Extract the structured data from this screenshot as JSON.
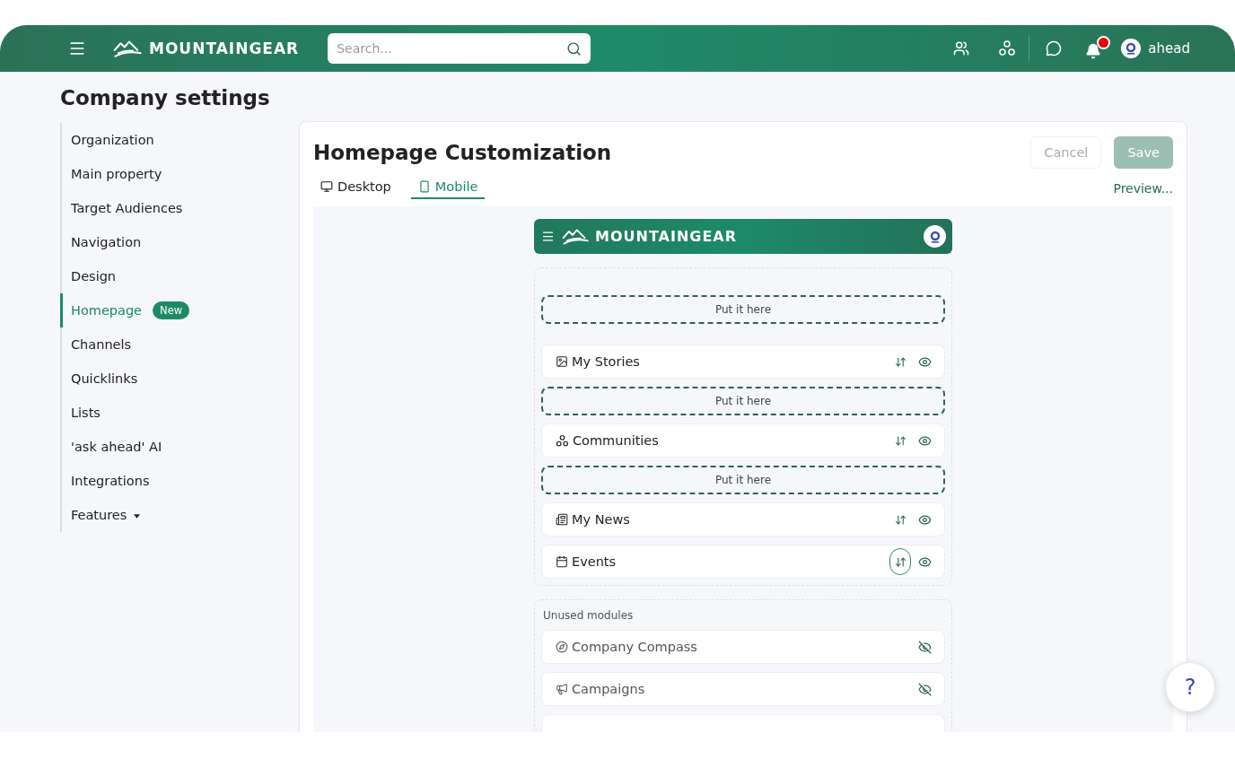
{
  "topbar": {
    "brand": "MOUNTAINGEAR",
    "search": {
      "placeholder": "Search..."
    },
    "notifications": {
      "unread": true
    },
    "user": "ahead"
  },
  "page_title": "Company settings",
  "sidebar": {
    "items": [
      {
        "label": "Organization",
        "selected": false
      },
      {
        "label": "Main property",
        "selected": false
      },
      {
        "label": "Target Audiences",
        "selected": false
      },
      {
        "label": "Navigation",
        "selected": false
      },
      {
        "label": "Design",
        "selected": false
      },
      {
        "label": "Homepage",
        "selected": true,
        "badge": "New"
      },
      {
        "label": "Channels",
        "selected": false
      },
      {
        "label": "Quicklinks",
        "selected": false
      },
      {
        "label": "Lists",
        "selected": false
      },
      {
        "label": "'ask ahead' AI",
        "selected": false
      },
      {
        "label": "Integrations",
        "selected": false
      },
      {
        "label": "Features",
        "selected": false,
        "dropdown": true
      }
    ]
  },
  "panel": {
    "title": "Homepage Customization",
    "cancel": "Cancel",
    "save": {
      "label": "Save",
      "disabled": true
    },
    "preview": "Preview...",
    "tabs": [
      {
        "label": "Desktop",
        "kind": "desktop",
        "selected": false
      },
      {
        "label": "Mobile",
        "kind": "mobile",
        "selected": true
      }
    ],
    "mobile_header": {
      "brand": "MOUNTAINGEAR"
    },
    "layout": [
      {
        "kind": "drop",
        "label": "Put it here"
      },
      {
        "kind": "image",
        "label": "My Stories",
        "focused": false
      },
      {
        "kind": "drop",
        "label": "Put it here"
      },
      {
        "kind": "communities",
        "label": "Communities",
        "focused": false
      },
      {
        "kind": "drop",
        "label": "Put it here"
      },
      {
        "kind": "news",
        "label": "My News",
        "focused": false
      },
      {
        "kind": "calendar",
        "label": "Events",
        "focused": true
      }
    ],
    "unused_title": "Unused modules",
    "unused_modules": [
      {
        "kind": "compass",
        "label": "Company Compass"
      },
      {
        "kind": "megaphone",
        "label": "Campaigns"
      }
    ]
  },
  "help": "?"
}
